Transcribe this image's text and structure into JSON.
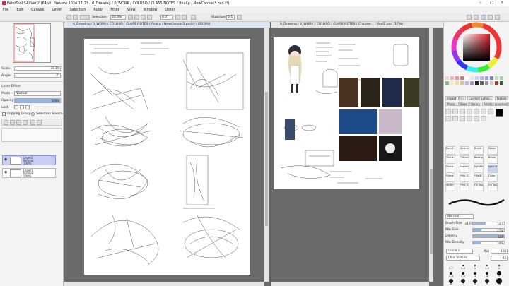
{
  "app": {
    "title": "PaintTool SAI Ver.2 (64bit) Preview.2024.11.23 - 0_Drawing / 0_WORK / COLOSO / CLASS NOTES / final p / NewCanvas3.psd (*)"
  },
  "menu": [
    "File",
    "Edit",
    "Canvas",
    "Layer",
    "Selection",
    "Ruler",
    "Filter",
    "View",
    "Window",
    "Other"
  ],
  "toolbar": {
    "selection_label": "Selection",
    "zoom": "33.3%",
    "angle": "0.0°",
    "stabilizer_label": "Stabilizer",
    "stabilizer_value": "S-1"
  },
  "left": {
    "scale_label": "Scale",
    "scale_value": "33.3%",
    "angle_label": "Angle",
    "angle_value": "0°",
    "layer_effect": "Layer Effect",
    "mode_label": "Mode",
    "mode_value": "Normal",
    "opacity_label": "Opacity",
    "opacity_value": "100%",
    "lock_label": "Lock",
    "clipping": "Clipping Group",
    "selection_source": "Selection Source",
    "layers": [
      {
        "name": "Layer2",
        "mode": "Normal",
        "opacity": "100%"
      },
      {
        "name": "Layer1",
        "mode": "Normal",
        "opacity": "100%"
      }
    ]
  },
  "doc1": {
    "title": "0_Drawing / 0_WORK / COLOSO / CLASS NOTES / final p / NewCanvas3.psd (*) (33.3%)"
  },
  "doc2": {
    "title": "0_Drawing / 0_WORK / COLOSO / CLASS NOTES / Chapter... / final2.psd (17%)"
  },
  "right": {
    "tabs": [
      "Import",
      "Print",
      "Current",
      "Extras...",
      "Texture",
      "Photo...",
      "Base",
      "library",
      "Artists",
      "unsorted"
    ],
    "brushes": [
      "Pencil",
      "Airbrush",
      "Brush",
      "Water",
      "*Sens...",
      "*Struct...",
      "Backgr...",
      "Brush",
      "*Sens...",
      "*sketch...",
      "lightMe...",
      "light St...",
      "*Sens...",
      "*flat S...",
      "*flatB...",
      "Color",
      "Writer",
      "*flat S...",
      "Fill Tool",
      "Fill Tool"
    ],
    "mode_value": "Normal",
    "brush_size_label": "Brush Size",
    "brush_size_mult": "x1.0",
    "brush_size_value": "24.0",
    "brush_size_fill": 0.4,
    "min_size_label": "Min Size",
    "min_size_value": "27%",
    "min_size_fill": 0.27,
    "density_label": "Density",
    "density_value": "100",
    "density_fill": 1.0,
    "min_density_label": "Min Density",
    "min_density_value": "24%",
    "min_density_fill": 0.24,
    "shape_value": "Circle s",
    "shape_max": "Max",
    "shape_num": "100",
    "texture_value": "[ No Texture ]",
    "texture_num": "95",
    "size_values": [
      "0.7",
      "0.8",
      "1",
      "1.5",
      "2",
      "2.3",
      "2.6",
      "3",
      "4",
      "5",
      "6",
      "7",
      "8",
      "9",
      "10"
    ]
  },
  "colors": {
    "accent": "#3d6dcc",
    "swatches": [
      "#f4d3d3",
      "#f0b8b8",
      "#e89a9a",
      "#c67f7f",
      "#ffffff",
      "#e8e8e8",
      "#d0d0f0",
      "#b8b8f0",
      "#9e9ee0",
      "#8080c0",
      "#c0e0c0",
      "#a0d0a0",
      "#80c080",
      "#f8f0c0",
      "#f0e0a0",
      "#e0c880",
      "#d0b0e0",
      "#b890d0",
      "#222222",
      "#666666",
      "#999999",
      "#cccccc",
      "#b03030",
      "#306030"
    ]
  }
}
